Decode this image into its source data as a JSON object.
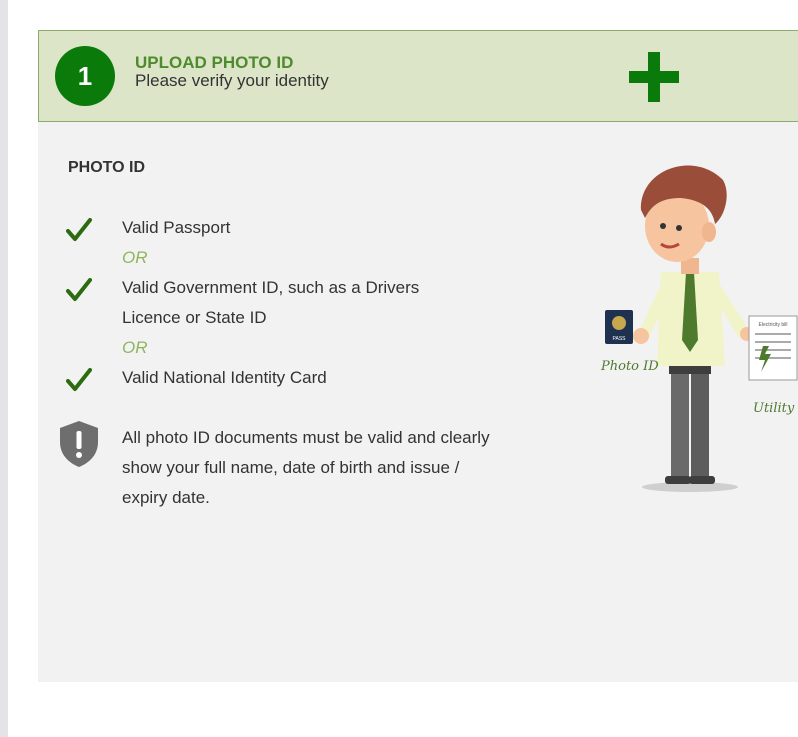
{
  "step": {
    "number": "1",
    "title": "UPLOAD PHOTO ID",
    "subtitle": "Please verify your identity"
  },
  "panel": {
    "heading": "PHOTO ID",
    "requirements": [
      {
        "text": "Valid Passport"
      },
      {
        "text": "Valid Government ID, such as a Drivers",
        "text2": "Licence or State ID"
      },
      {
        "text": "Valid National Identity Card"
      }
    ],
    "or_label": "OR",
    "note": "All photo ID documents must be valid and clearly show your full name, date of birth and issue / expiry date."
  },
  "illustration": {
    "photo_label": "Photo ID",
    "utility_label": "Utility Bill",
    "passport_label": "PASS",
    "bill_label": "Electricity bill"
  },
  "colors": {
    "accent_green": "#0a7a0a",
    "header_bg": "#dde5c8",
    "or_green": "#8fb55c"
  }
}
